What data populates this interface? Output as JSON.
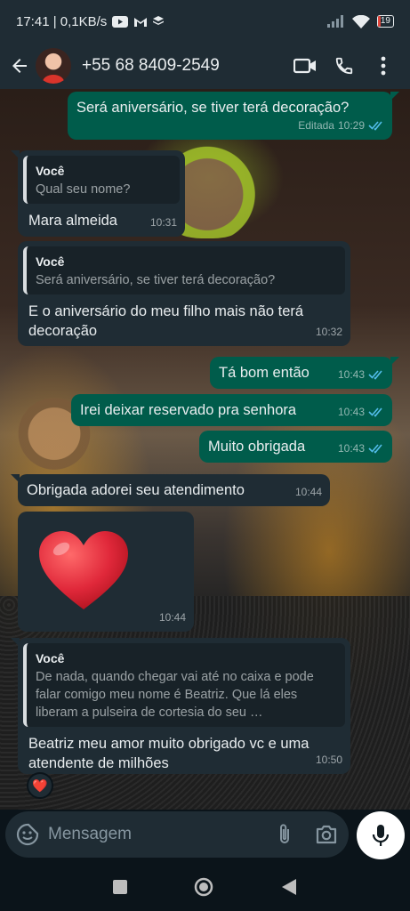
{
  "status_bar": {
    "time_speed": "17:41 | 0,1KB/s",
    "battery": "19",
    "battery_percent": 19,
    "icons": [
      "youtube-icon",
      "gmail-icon",
      "stack-icon",
      "signal-icon",
      "wifi-icon",
      "battery-icon"
    ]
  },
  "header": {
    "contact_name": "+55 68 8409-2549",
    "icons": [
      "back-arrow-icon",
      "avatar",
      "video-call-icon",
      "phone-icon",
      "more-vert-icon"
    ]
  },
  "messages": [
    {
      "direction": "out",
      "text": "Será aniversário, se tiver terá decoração?",
      "edited_label": "Editada",
      "time": "10:29",
      "status": "read"
    },
    {
      "direction": "in",
      "quote_author": "Você",
      "quote_text": "Qual seu nome?",
      "text": "Mara almeida",
      "time": "10:31"
    },
    {
      "direction": "in",
      "quote_author": "Você",
      "quote_text": "Será aniversário, se tiver terá decoração?",
      "text": "E o aniversário do meu filho mais não terá decoração",
      "time": "10:32"
    },
    {
      "direction": "out",
      "text": "Tá bom então",
      "time": "10:43",
      "status": "read"
    },
    {
      "direction": "out",
      "text": "Irei deixar reservado pra senhora",
      "time": "10:43",
      "status": "read"
    },
    {
      "direction": "out",
      "text": "Muito obrigada",
      "time": "10:43",
      "status": "read"
    },
    {
      "direction": "in",
      "text": "Obrigada adorei seu atendimento",
      "time": "10:44"
    },
    {
      "direction": "in",
      "emoji": "red-heart",
      "time": "10:44"
    },
    {
      "direction": "in",
      "quote_author": "Você",
      "quote_text": "De nada, quando chegar vai até no caixa e pode falar comigo meu nome é Beatriz. Que lá eles liberam a pulseira de cortesia do seu …",
      "text": "Beatriz meu amor muito obrigado vc e uma atendente de milhões",
      "time": "10:50",
      "reaction": "❤️"
    }
  ],
  "input": {
    "placeholder": "Mensagem",
    "icons": [
      "sticker-icon",
      "attach-icon",
      "camera-icon",
      "mic-icon"
    ]
  },
  "nav_bar": {
    "icons": [
      "recent-apps-icon",
      "home-icon",
      "back-icon"
    ]
  },
  "colors": {
    "outgoing_bubble": "#005c4b",
    "incoming_bubble": "#1f2c34",
    "header_bg": "#1f2c34",
    "read_ticks": "#53bdeb",
    "heart": "#e0283a"
  }
}
